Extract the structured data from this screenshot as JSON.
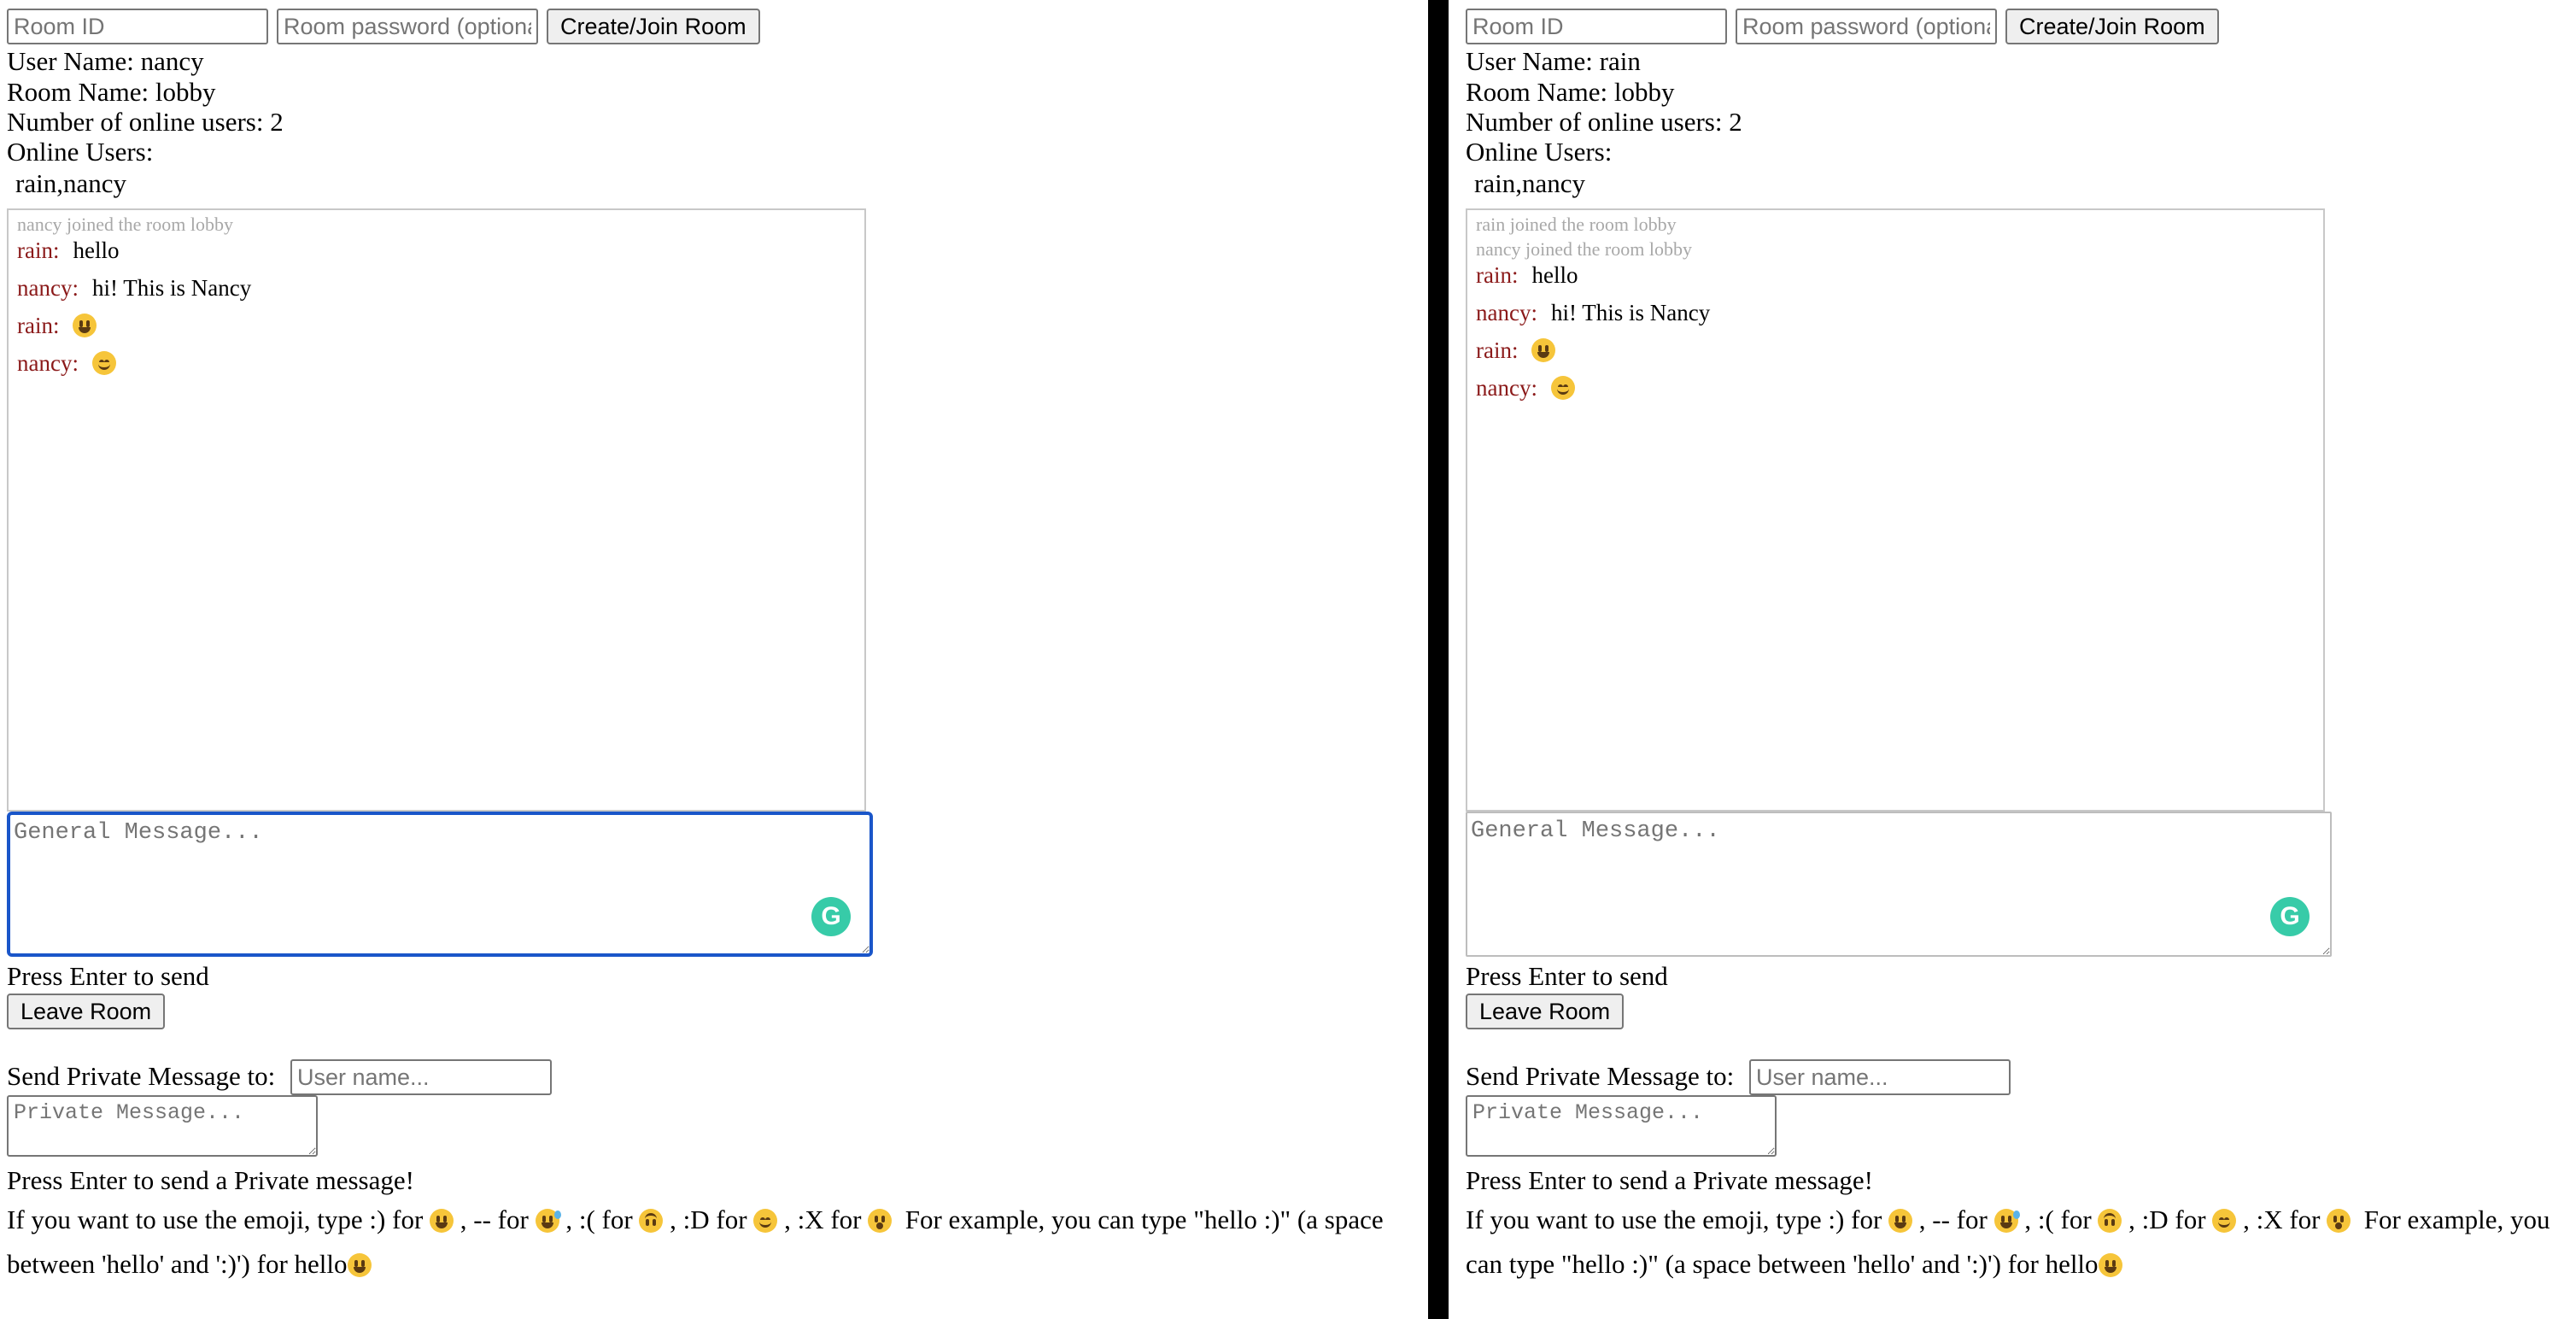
{
  "shared": {
    "room_id_placeholder": "Room ID",
    "room_password_placeholder": "Room password (optional)",
    "create_join_label": "Create/Join Room",
    "general_message_placeholder": "General Message...",
    "press_enter_text": "Press Enter to send",
    "leave_room_label": "Leave Room",
    "private_to_label": "Send Private Message to:",
    "private_user_placeholder": "User name...",
    "private_message_placeholder": "Private Message...",
    "press_enter_private_text": "Press Enter to send a Private message!",
    "grammarly_letter": "G",
    "emoji_help": {
      "intro": "If you want to use the emoji, type :) for",
      "dash_for": ", -- for",
      "frown_for": ", :( for",
      "d_for": ", :D for",
      "x_for": ", :X for",
      "example": "For example, you can type \"hello :)\" (a space between 'hello' and ':)') for hello"
    }
  },
  "left": {
    "user_name_line": "User Name: nancy",
    "room_name_line": "Room Name: lobby",
    "online_count_line": "Number of online users: 2",
    "online_users_label": "Online Users:",
    "online_users": "rain,nancy",
    "system_messages": [
      "nancy joined the room lobby"
    ],
    "messages": [
      {
        "user": "rain:",
        "text": "hello",
        "emoji": ""
      },
      {
        "user": "nancy:",
        "text": "hi! This is Nancy",
        "emoji": ""
      },
      {
        "user": "rain:",
        "text": "",
        "emoji": "smile"
      },
      {
        "user": "nancy:",
        "text": "",
        "emoji": "blush"
      }
    ]
  },
  "right": {
    "user_name_line": "User Name: rain",
    "room_name_line": "Room Name: lobby",
    "online_count_line": "Number of online users: 2",
    "online_users_label": "Online Users:",
    "online_users": "rain,nancy",
    "system_messages": [
      "rain joined the room lobby",
      "nancy joined the room lobby"
    ],
    "messages": [
      {
        "user": "rain:",
        "text": "hello",
        "emoji": ""
      },
      {
        "user": "nancy:",
        "text": "hi! This is Nancy",
        "emoji": ""
      },
      {
        "user": "rain:",
        "text": "",
        "emoji": "smile"
      },
      {
        "user": "nancy:",
        "text": "",
        "emoji": "blush"
      }
    ]
  },
  "colors": {
    "username_color": "#8b1a1a",
    "system_message_color": "#a8a8a8",
    "focus_border": "#1a56c9",
    "divider": "#000000",
    "grammarly": "#15c39a"
  }
}
